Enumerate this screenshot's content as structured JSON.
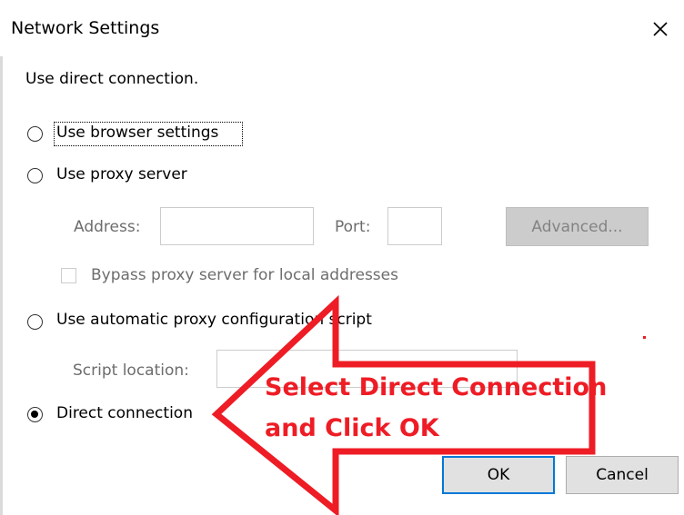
{
  "window": {
    "title": "Network Settings",
    "close_icon": "close-icon"
  },
  "intro": "Use direct connection.",
  "options": {
    "browser": {
      "label": "Use browser settings",
      "selected": false
    },
    "proxy": {
      "label": "Use proxy server",
      "selected": false
    },
    "auto": {
      "label": "Use automatic proxy configuration script",
      "selected": false
    },
    "direct": {
      "label": "Direct connection",
      "selected": true
    }
  },
  "proxy_fields": {
    "address_label": "Address:",
    "address_value": "",
    "port_label": "Port:",
    "port_value": "",
    "advanced_label": "Advanced...",
    "bypass_label": "Bypass proxy server for local addresses",
    "bypass_checked": false
  },
  "script_fields": {
    "location_label": "Script location:",
    "location_value": ""
  },
  "buttons": {
    "ok": "OK",
    "cancel": "Cancel"
  },
  "annotation": {
    "line1": "Select Direct Connection",
    "line2": "and Click OK",
    "color": "#ee1c25"
  },
  "colors": {
    "accent": "#0078d7",
    "disabled_text": "#6d6d6d"
  }
}
